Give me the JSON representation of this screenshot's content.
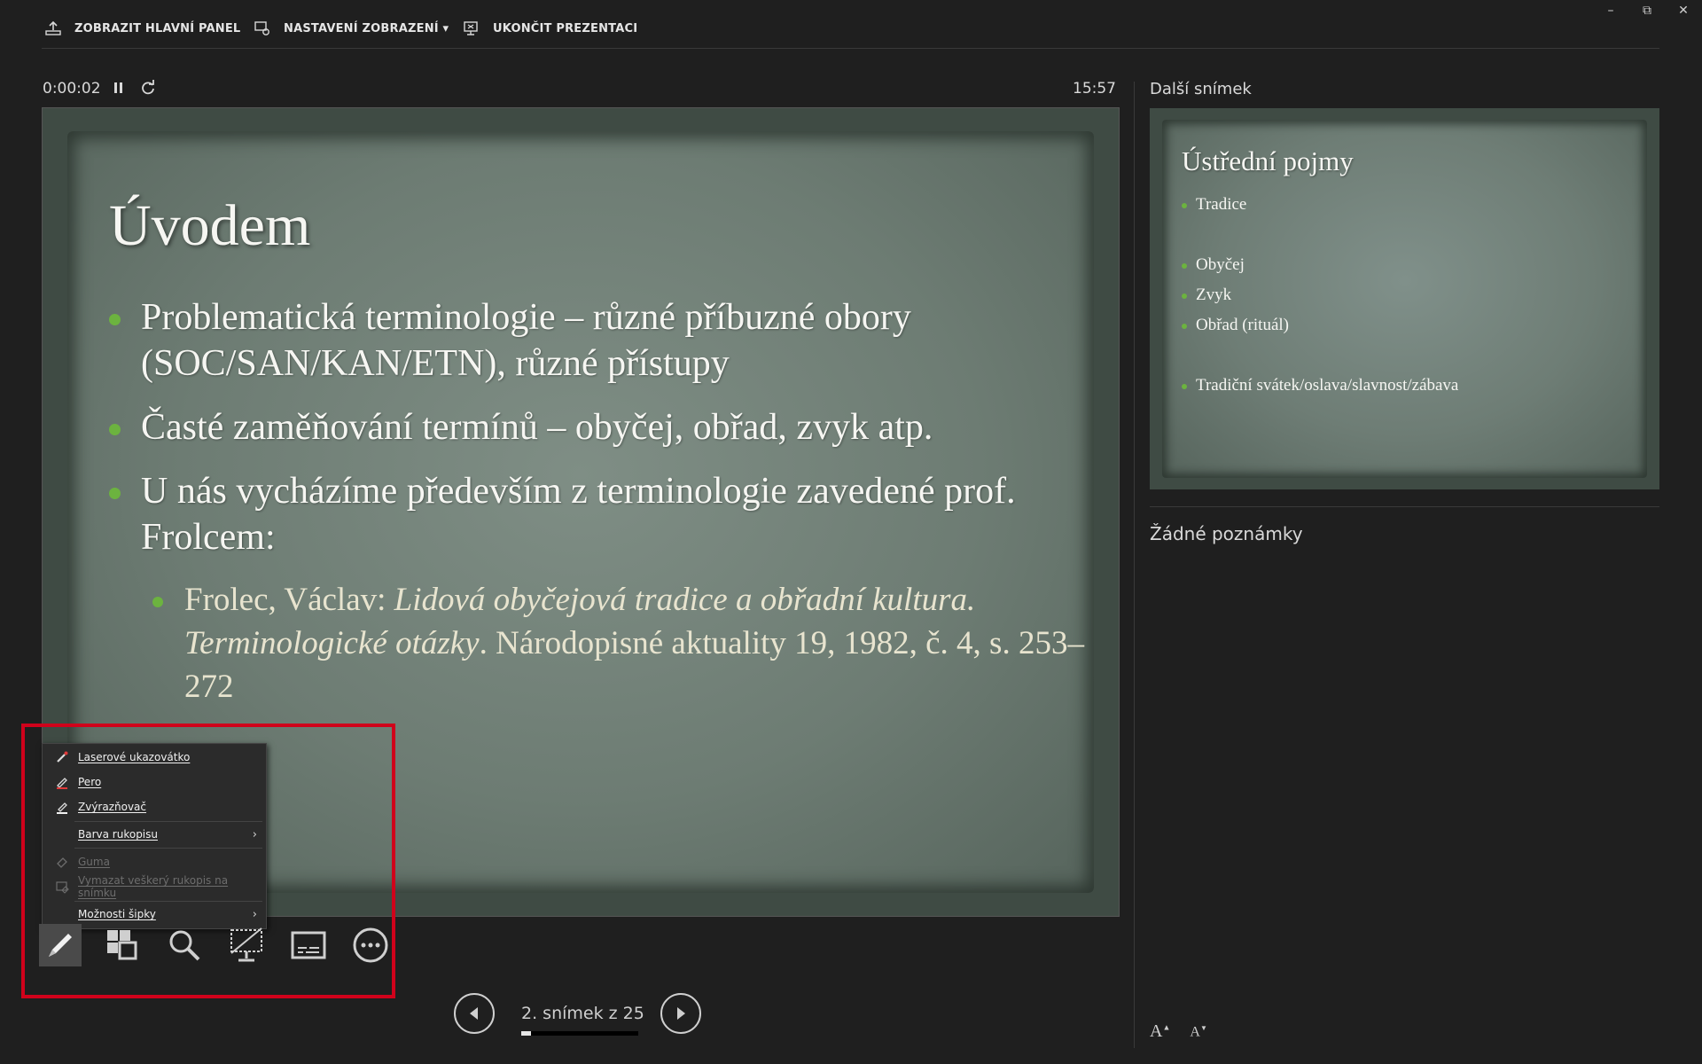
{
  "topbar": {
    "show_taskbar": "ZOBRAZIT HLAVNÍ PANEL",
    "display_settings": "NASTAVENÍ ZOBRAZENÍ ▾",
    "end_show": "UKONČIT PREZENTACI"
  },
  "window_controls": {
    "minimize": "–",
    "restore": "⧉",
    "close": "✕"
  },
  "timer": {
    "elapsed": "0:00:02",
    "clock": "15:57"
  },
  "slide": {
    "title": "Úvodem",
    "bullets": [
      "Problematická terminologie – různé příbuzné obory (SOC/SAN/KAN/ETN), různé přístupy",
      "Časté zaměňování termínů – obyčej, obřad, zvyk atp.",
      "U nás vycházíme především z terminologie zavedené prof. Frolcem:"
    ],
    "sub_bullet": {
      "author": "Frolec, Václav: ",
      "title_italic": "Lidová obyčejová tradice a obřadní kultura. Terminologické otázky",
      "rest": ". Národopisné aktuality 19, 1982, č. 4, s. 253–272"
    }
  },
  "next_slide": {
    "label": "Další snímek",
    "title": "Ústřední pojmy",
    "items": [
      "Tradice",
      "Obyčej",
      "Zvyk",
      "Obřad (rituál)",
      "Tradiční svátek/oslava/slavnost/zábava"
    ]
  },
  "notes": {
    "text": "Žádné poznámky",
    "font_bigger": "A",
    "font_smaller": "A"
  },
  "pen_menu": {
    "items": [
      {
        "label": "Laserové ukazovátko",
        "icon": "laser-pointer-icon",
        "enabled": true
      },
      {
        "label": "Pero",
        "icon": "pen-icon",
        "enabled": true
      },
      {
        "label": "Zvýrazňovač",
        "icon": "highlighter-icon",
        "enabled": true
      },
      {
        "label": "Barva rukopisu",
        "icon": "",
        "enabled": true,
        "submenu": true
      },
      {
        "label": "Guma",
        "icon": "eraser-icon",
        "enabled": false
      },
      {
        "label": "Vymazat veškerý rukopis na snímku",
        "icon": "erase-all-icon",
        "enabled": false
      },
      {
        "label": "Možnosti šipky",
        "icon": "",
        "enabled": true,
        "submenu": true
      }
    ]
  },
  "tools": [
    "pen-tool-icon",
    "see-all-slides-icon",
    "zoom-icon",
    "black-screen-icon",
    "subtitles-icon",
    "more-options-icon"
  ],
  "navigation": {
    "slide_counter": "2. snímek z 25",
    "progress": 0.08
  },
  "colors": {
    "accent_green": "#6cb33f",
    "highlight_red": "#d0021b"
  }
}
